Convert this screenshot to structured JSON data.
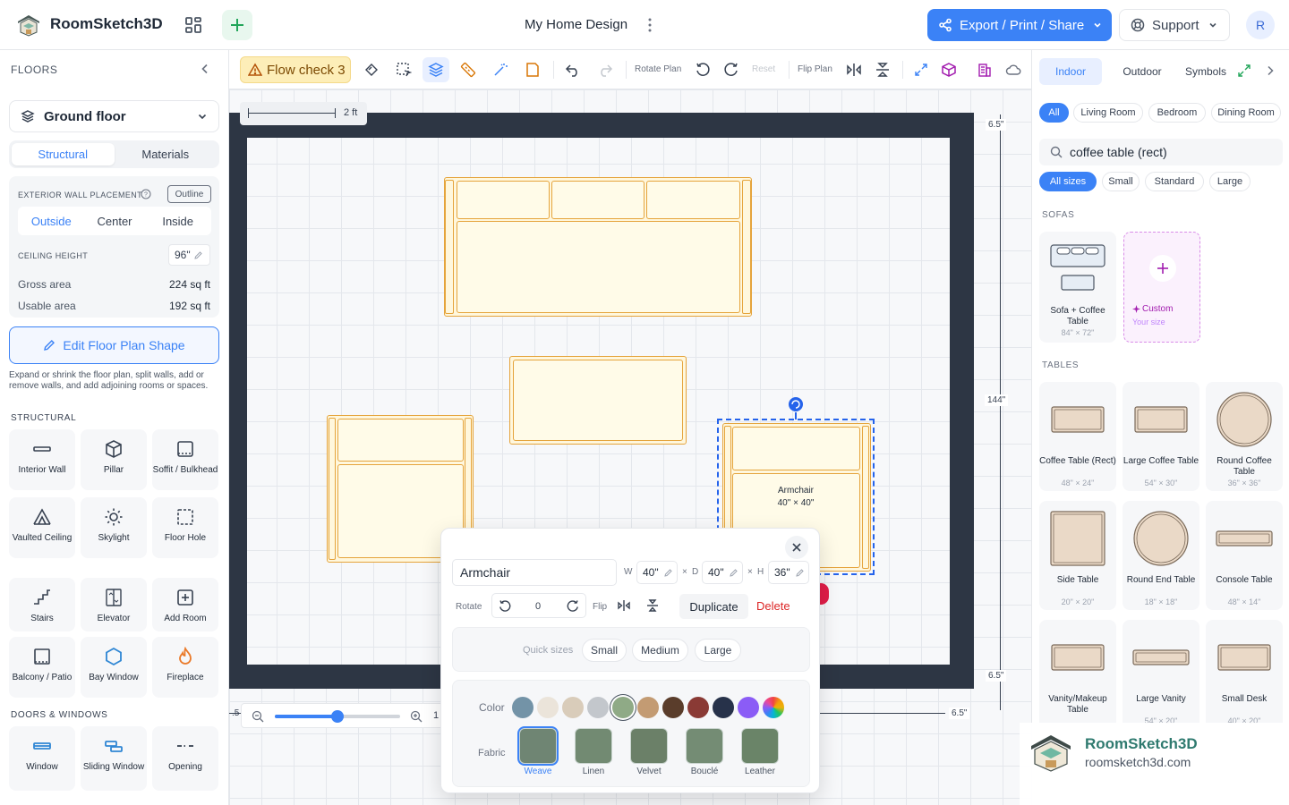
{
  "app": {
    "title": "RoomSketch3D",
    "document_title": "My Home Design",
    "avatar_initial": "R"
  },
  "header": {
    "export_label": "Export / Print / Share",
    "support_label": "Support"
  },
  "left": {
    "floors_heading": "FLOORS",
    "floor_selected": "Ground floor",
    "tabs": [
      "Structural",
      "Materials"
    ],
    "wall_placement_caption": "EXTERIOR WALL PLACEMENT",
    "outline_tag": "Outline",
    "wall_options": [
      "Outside",
      "Center",
      "Inside"
    ],
    "ceiling_caption": "CEILING HEIGHT",
    "ceiling_value": "96\"",
    "gross_label": "Gross area",
    "gross_value": "224 sq ft",
    "usable_label": "Usable area",
    "usable_value": "192 sq ft",
    "edit_shape_label": "Edit Floor Plan Shape",
    "edit_help": "Expand or shrink the floor plan, split walls, add or remove walls, and add adjoining rooms or spaces.",
    "structural_heading": "STRUCTURAL",
    "structural_tools": [
      {
        "label": "Interior Wall",
        "icon": "wall-icon"
      },
      {
        "label": "Pillar",
        "icon": "cube-icon"
      },
      {
        "label": "Soffit / Bulkhead",
        "icon": "soffit-icon"
      },
      {
        "label": "Vaulted Ceiling",
        "icon": "tent-icon"
      },
      {
        "label": "Skylight",
        "icon": "sun-icon"
      },
      {
        "label": "Floor Hole",
        "icon": "dashed-square-icon"
      },
      {
        "label": "Stairs",
        "icon": "stairs-icon"
      },
      {
        "label": "Elevator",
        "icon": "elevator-icon"
      },
      {
        "label": "Add Room",
        "icon": "plus-square-icon"
      },
      {
        "label": "Balcony / Patio",
        "icon": "balcony-icon"
      },
      {
        "label": "Bay Window",
        "icon": "hexagon-icon"
      },
      {
        "label": "Fireplace",
        "icon": "flame-icon"
      }
    ],
    "doors_heading": "DOORS & WINDOWS",
    "door_tools": [
      {
        "label": "Window",
        "icon": "window-icon"
      },
      {
        "label": "Sliding Window",
        "icon": "sliding-window-icon"
      },
      {
        "label": "Opening",
        "icon": "opening-icon"
      }
    ]
  },
  "toolbar": {
    "flow_check_label": "Flow check 3",
    "rotate_plan_label": "Rotate Plan",
    "reset_label": "Reset",
    "flip_plan_label": "Flip Plan"
  },
  "canvas": {
    "scale_label": "2 ft",
    "dim_top_right": "6.5\"",
    "dim_height": "144\"",
    "dim_bottom_right": "6.5\"",
    "dim_bottom_corner": "6.5\"",
    "dim_left_partial": ".5",
    "armchair_label": "Armchair",
    "armchair_size": "40\" × 40\"",
    "zoom_value": "1",
    "zoom_fraction": 0.5
  },
  "popup": {
    "item_name": "Armchair",
    "w_label": "W",
    "w_value": "40\"",
    "d_label": "D",
    "d_value": "40\"",
    "h_label": "H",
    "h_value": "36\"",
    "sep": "×",
    "rotate_label": "Rotate",
    "rotate_value": "0",
    "flip_label": "Flip",
    "duplicate_label": "Duplicate",
    "delete_label": "Delete",
    "quick_sizes_label": "Quick sizes",
    "quick_sizes": [
      "Small",
      "Medium",
      "Large"
    ],
    "color_label": "Color",
    "colors": [
      "#7393a7",
      "#ebe4da",
      "#d9ccba",
      "#c3c7cc",
      "#8faa86",
      "#c39b73",
      "#5a3d2b",
      "#8a3a35",
      "#27324a",
      "#8b5cf6"
    ],
    "selected_color": "#8faa86",
    "fabric_label": "Fabric",
    "fabrics": [
      {
        "label": "Weave",
        "color": "#6f8573"
      },
      {
        "label": "Linen",
        "color": "#728a72"
      },
      {
        "label": "Velvet",
        "color": "#6b8068"
      },
      {
        "label": "Bouclé",
        "color": "#748c74"
      },
      {
        "label": "Leather",
        "color": "#6a8468"
      }
    ],
    "selected_fabric": "Weave"
  },
  "right": {
    "tabs": [
      "Indoor",
      "Outdoor",
      "Symbols"
    ],
    "rooms": [
      "All",
      "Living Room",
      "Bedroom",
      "Dining Room"
    ],
    "search_value": "coffee table (rect)",
    "sizes": [
      "All sizes",
      "Small",
      "Standard",
      "Large"
    ],
    "sofas_heading": "SOFAS",
    "sofa_card": {
      "name": "Sofa + Coffee Table",
      "size": "84\" × 72\""
    },
    "custom_card": {
      "name": "Custom",
      "size": "Your size"
    },
    "tables_heading": "TABLES",
    "tables": [
      {
        "name": "Coffee Table (Rect)",
        "size": "48\" × 24\""
      },
      {
        "name": "Large Coffee Table",
        "size": "54\" × 30\""
      },
      {
        "name": "Round Coffee Table",
        "size": "36\" × 36\""
      },
      {
        "name": "Side Table",
        "size": "20\" × 20\""
      },
      {
        "name": "Round End Table",
        "size": "18\" × 18\""
      },
      {
        "name": "Console Table",
        "size": "48\" × 14\""
      },
      {
        "name": "Vanity/Makeup Table",
        "size": ""
      },
      {
        "name": "Large Vanity",
        "size": "54\" × 20\""
      },
      {
        "name": "Small Desk",
        "size": "40\" × 20\""
      }
    ]
  },
  "watermark": {
    "title": "RoomSketch3D",
    "url": "roomsketch3d.com"
  }
}
